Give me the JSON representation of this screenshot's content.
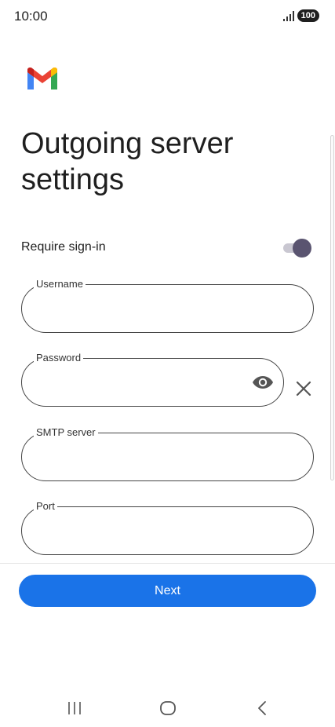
{
  "status_bar": {
    "time": "10:00",
    "battery": "100"
  },
  "icons": {
    "logo": "gmail-logo",
    "password_toggle": "eye-icon",
    "clear": "close-icon",
    "nav_recent": "recent-apps-icon",
    "nav_home": "home-icon",
    "nav_back": "back-icon"
  },
  "page": {
    "title": "Outgoing server settings"
  },
  "require_signin": {
    "label": "Require sign-in",
    "enabled": true
  },
  "fields": {
    "username": {
      "label": "Username",
      "value": ""
    },
    "password": {
      "label": "Password",
      "value": ""
    },
    "smtp_server": {
      "label": "SMTP server",
      "value": ""
    },
    "port": {
      "label": "Port",
      "value": ""
    }
  },
  "actions": {
    "next_label": "Next"
  },
  "colors": {
    "accent": "#1a73e8",
    "toggle_thumb": "#5a5470",
    "toggle_track": "#c9c7d1"
  }
}
